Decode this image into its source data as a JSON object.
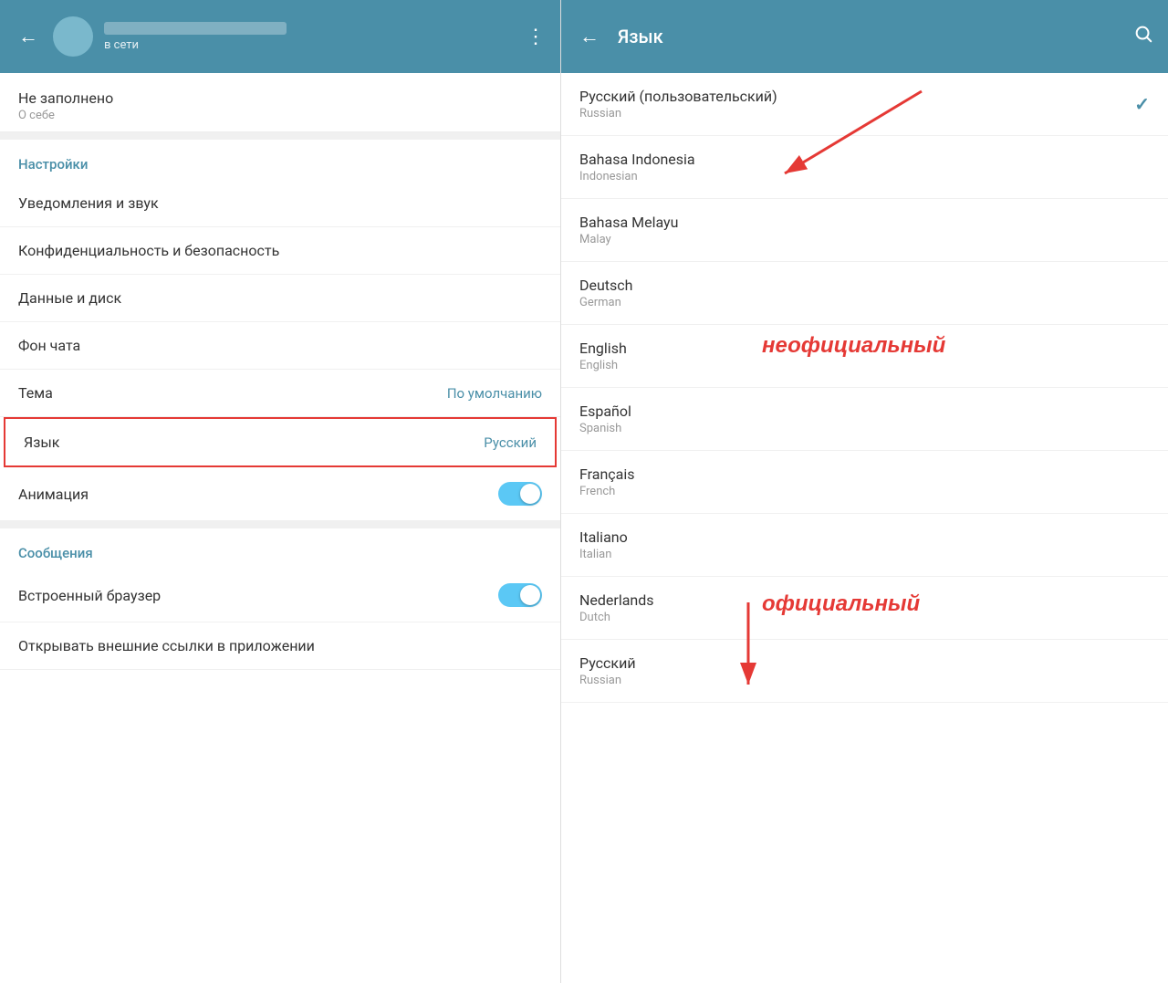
{
  "left_panel": {
    "header": {
      "back_label": "←",
      "status": "в сети",
      "more_icon": "⋮"
    },
    "profile": {
      "field_label": "Не заполнено",
      "field_sublabel": "О себе"
    },
    "settings_section_label": "Настройки",
    "settings_items": [
      {
        "label": "Уведомления и звук",
        "value": "",
        "type": "nav"
      },
      {
        "label": "Конфиденциальность и безопасность",
        "value": "",
        "type": "nav"
      },
      {
        "label": "Данные и диск",
        "value": "",
        "type": "nav"
      },
      {
        "label": "Фон чата",
        "value": "",
        "type": "nav"
      },
      {
        "label": "Тема",
        "value": "По умолчанию",
        "type": "value"
      },
      {
        "label": "Язык",
        "value": "Русский",
        "type": "value",
        "highlighted": true
      },
      {
        "label": "Анимация",
        "value": "",
        "type": "toggle"
      }
    ],
    "messages_section_label": "Сообщения",
    "messages_items": [
      {
        "label": "Встроенный браузер",
        "value": "",
        "type": "toggle"
      },
      {
        "label": "Открывать внешние ссылки в приложении",
        "value": "",
        "type": "toggle"
      }
    ]
  },
  "right_panel": {
    "header": {
      "back_label": "←",
      "title": "Язык",
      "search_icon": "🔍"
    },
    "languages": [
      {
        "native": "Русский (пользовательский)",
        "english": "Russian",
        "selected": true
      },
      {
        "native": "Bahasa Indonesia",
        "english": "Indonesian",
        "selected": false
      },
      {
        "native": "Bahasa Melayu",
        "english": "Malay",
        "selected": false
      },
      {
        "native": "Deutsch",
        "english": "German",
        "selected": false
      },
      {
        "native": "English",
        "english": "English",
        "selected": false
      },
      {
        "native": "Español",
        "english": "Spanish",
        "selected": false
      },
      {
        "native": "Français",
        "english": "French",
        "selected": false
      },
      {
        "native": "Italiano",
        "english": "Italian",
        "selected": false
      },
      {
        "native": "Nederlands",
        "english": "Dutch",
        "selected": false
      },
      {
        "native": "Русский",
        "english": "Russian",
        "selected": false
      }
    ]
  },
  "annotations": {
    "unofficial_label": "неофициальный",
    "official_label": "официальный"
  }
}
